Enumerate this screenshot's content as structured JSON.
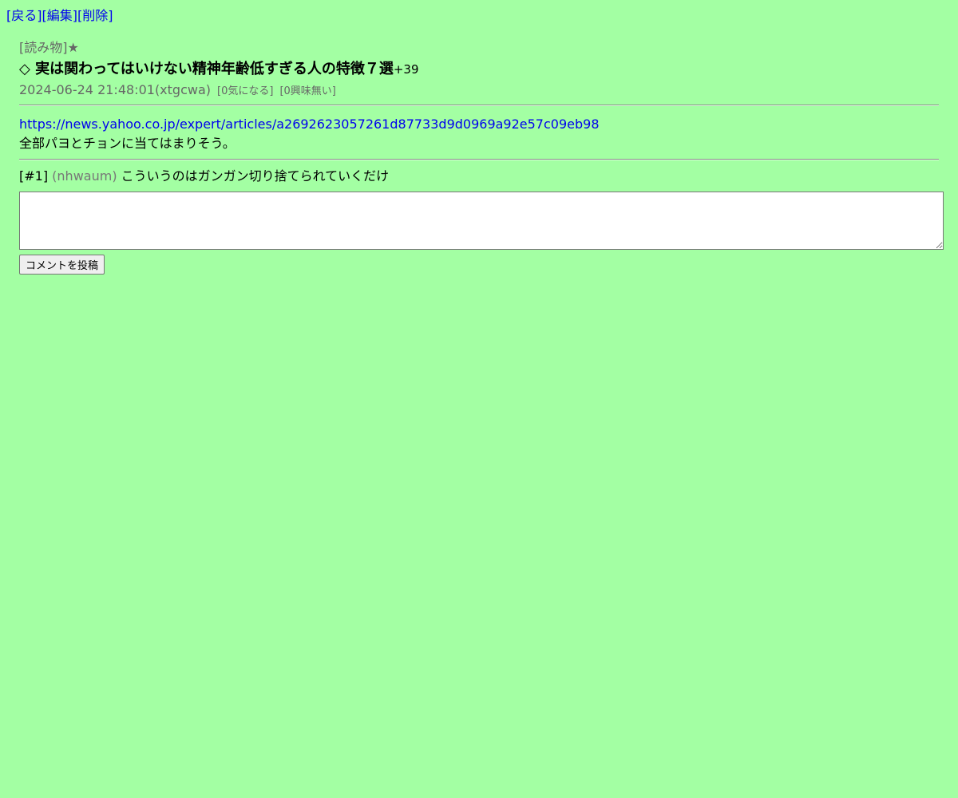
{
  "nav": {
    "back": "[戻る]",
    "edit": "[編集]",
    "delete": "[削除]"
  },
  "article": {
    "category": "[読み物]★",
    "title_prefix": "◇ ",
    "title": "実は関わってはいけない精神年齢低すぎる人の特徴７選",
    "score": "+39",
    "datetime": "2024-06-24 21:48:01",
    "author": "(xtgcwa)",
    "interested": "[0気になる]",
    "not_interested": "[0興味無い]",
    "url": "https://news.yahoo.co.jp/expert/articles/a2692623057261d87733d9d0969a92e57c09eb98",
    "body": "全部パヨとチョンに当てはまりそう。"
  },
  "comments": [
    {
      "num": "[#1]",
      "user": "(nhwaum)",
      "text": "こういうのはガンガン切り捨てられていくだけ"
    }
  ],
  "form": {
    "submit_label": "コメントを投稿"
  },
  "colors": {
    "background": "#a3ffa3",
    "link": "#0000ee",
    "muted": "#666666"
  }
}
